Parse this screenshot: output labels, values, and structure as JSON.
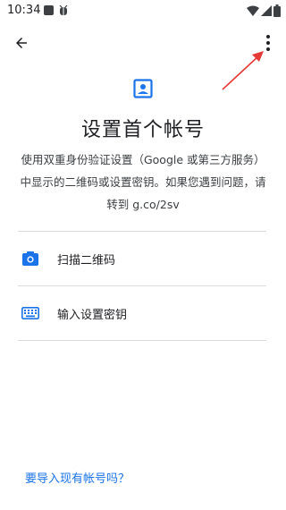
{
  "status_bar": {
    "time": "10:34",
    "icons": [
      "app-notification-icon",
      "bug-icon",
      "wifi-icon",
      "signal-icon",
      "battery-icon"
    ]
  },
  "top_bar": {
    "back_icon": "arrow-back-icon",
    "more_icon": "more-vert-icon"
  },
  "hero": {
    "icon": "account-box-icon",
    "title": "设置首个帐号"
  },
  "description": {
    "line1": "使用双重身份验证设置（Google 或第三方服务）",
    "line2": "中显示的二维码或设置密钥。如果您遇到问题，请",
    "line3": "转到 g.co/2sv"
  },
  "options": [
    {
      "icon": "camera-icon",
      "label": "扫描二维码"
    },
    {
      "icon": "keyboard-icon",
      "label": "输入设置密钥"
    }
  ],
  "footer": {
    "import_link": "要导入现有帐号吗？"
  },
  "colors": {
    "accent": "#1a73e8",
    "annotation": "#e53935",
    "text": "#202124",
    "divider": "#dadce0"
  }
}
